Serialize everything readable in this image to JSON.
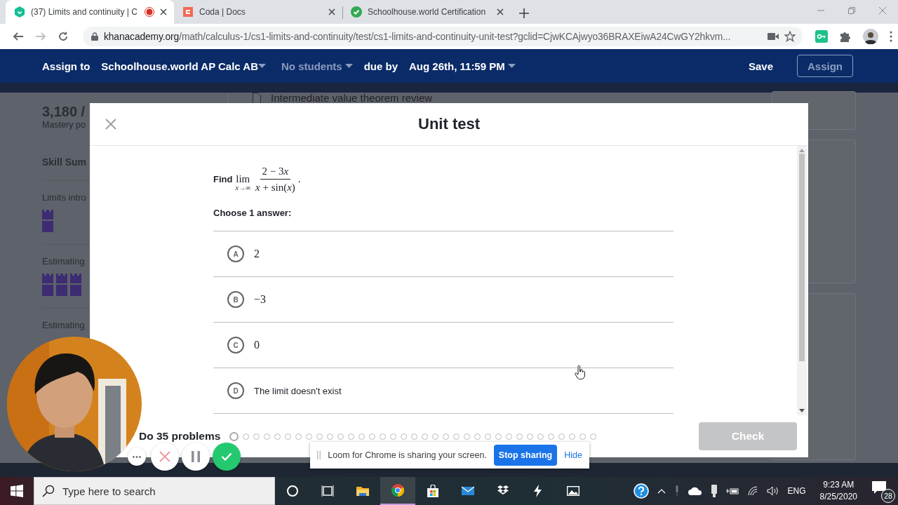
{
  "browser": {
    "tabs": [
      {
        "title": "(37) Limits and continuity | C",
        "kind": "khan",
        "selected": true,
        "recording": true
      },
      {
        "title": "Coda | Docs",
        "kind": "coda",
        "selected": false,
        "recording": false
      },
      {
        "title": "Schoolhouse.world Certification",
        "kind": "check",
        "selected": false,
        "recording": false
      }
    ],
    "url": {
      "host": "khanacademy.org",
      "path": "/math/calculus-1/cs1-limits-and-continuity/test/cs1-limits-and-continuity-unit-test?gclid=CjwKCAjwyo36BRAXEiwA24CwGY2hkvm..."
    }
  },
  "header": {
    "assign_label": "Assign to",
    "class_name": "Schoolhouse.world AP Calc AB",
    "students": {
      "label": "No students",
      "disabled": true
    },
    "due_label": "due by",
    "due_date": "Aug 26th, 11:59 PM",
    "save": "Save",
    "assign": {
      "label": "Assign",
      "disabled": true
    }
  },
  "background": {
    "points": "3,180 /",
    "points_caption": "Mastery po",
    "section_title": "Skill Sum",
    "review_link": "Intermediate value theorem review",
    "skills": [
      {
        "name": "Limits intro",
        "castles": [
          {
            "filled": true
          }
        ]
      },
      {
        "name": "Estimating",
        "castles": [
          {
            "filled": true
          },
          {
            "filled": true
          },
          {
            "filled": true
          }
        ]
      },
      {
        "name": "Estimating"
      }
    ]
  },
  "modal": {
    "title": "Unit test",
    "question": {
      "prefix": "Find",
      "operator": "lim",
      "subscript": "x→∞",
      "numerator": "2 − 3",
      "numerator_variable": "x",
      "denominator": "*x* + sin(*x*)",
      "suffix": "."
    },
    "prompt": "Choose 1 answer:",
    "choices": [
      {
        "letter": "A",
        "text": "2",
        "kind": "math",
        "selected": false
      },
      {
        "letter": "B",
        "text": "−3",
        "kind": "math",
        "selected": false
      },
      {
        "letter": "C",
        "text": "0",
        "kind": "math",
        "selected": false
      },
      {
        "letter": "D",
        "text": "The limit doesn't exist",
        "kind": "text",
        "selected": false
      }
    ],
    "progress_label": "Do 35 problems",
    "progress": [
      {
        "selected": true
      },
      {
        "selected": false
      },
      {
        "selected": false
      },
      {
        "selected": false
      },
      {
        "selected": false
      },
      {
        "selected": false
      },
      {
        "selected": false
      },
      {
        "selected": false
      },
      {
        "selected": false
      },
      {
        "selected": false
      },
      {
        "selected": false
      },
      {
        "selected": false
      },
      {
        "selected": false
      },
      {
        "selected": false
      },
      {
        "selected": false
      },
      {
        "selected": false
      },
      {
        "selected": false
      },
      {
        "selected": false
      },
      {
        "selected": false
      },
      {
        "selected": false
      },
      {
        "selected": false
      },
      {
        "selected": false
      },
      {
        "selected": false
      },
      {
        "selected": false
      },
      {
        "selected": false
      },
      {
        "selected": false
      },
      {
        "selected": false
      },
      {
        "selected": false
      },
      {
        "selected": false
      },
      {
        "selected": false
      },
      {
        "selected": false
      },
      {
        "selected": false
      },
      {
        "selected": false
      },
      {
        "selected": false
      },
      {
        "selected": false
      }
    ],
    "check": {
      "label": "Check",
      "disabled": true
    }
  },
  "loom": {
    "message": "Loom for Chrome is sharing your screen.",
    "stop": "Stop sharing",
    "hide": "Hide"
  },
  "taskbar": {
    "search_placeholder": "Type here to search",
    "language": "ENG",
    "time": "9:23 AM",
    "date": "8/25/2020",
    "notifications": "28"
  }
}
